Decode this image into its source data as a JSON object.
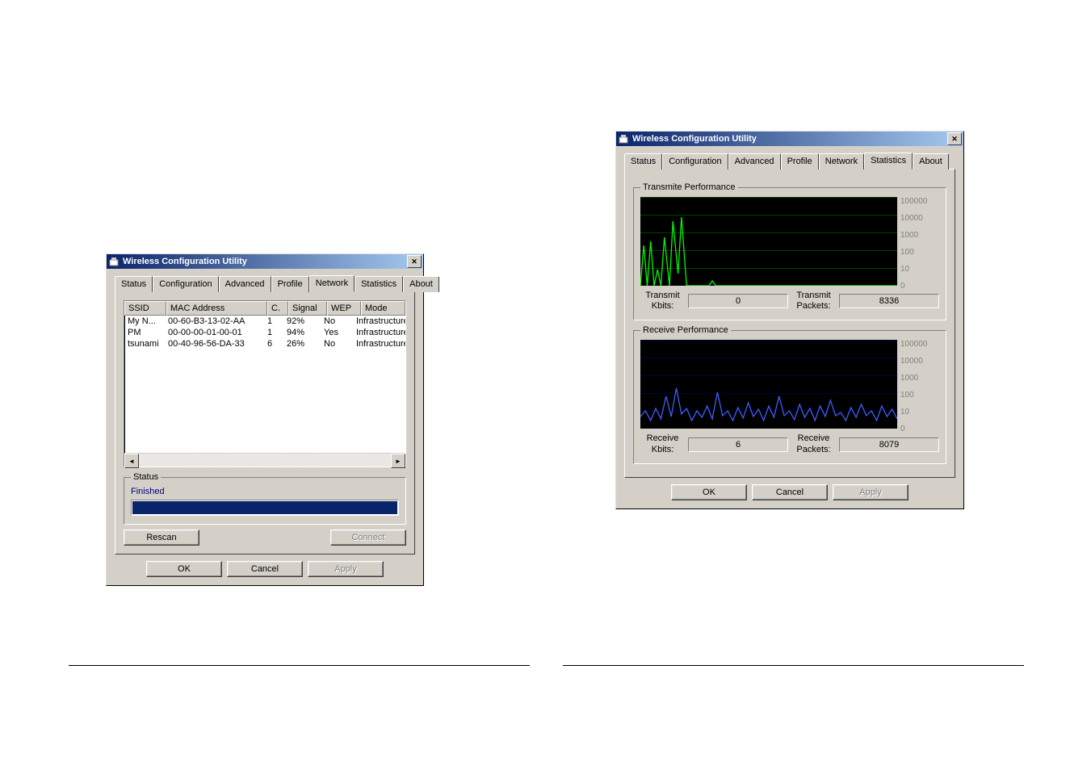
{
  "window1": {
    "title": "Wireless Configuration Utility",
    "tabs": [
      "Status",
      "Configuration",
      "Advanced",
      "Profile",
      "Network",
      "Statistics",
      "About"
    ],
    "active_tab": "Network",
    "columns": {
      "ssid": "SSID",
      "mac": "MAC Address",
      "c": "C.",
      "signal": "Signal",
      "wep": "WEP",
      "mode": "Mode"
    },
    "rows": [
      {
        "ssid": "My N...",
        "mac": "00-60-B3-13-02-AA",
        "c": "1",
        "signal": "92%",
        "wep": "No",
        "mode": "Infrastructure"
      },
      {
        "ssid": "PM",
        "mac": "00-00-00-01-00-01",
        "c": "1",
        "signal": "94%",
        "wep": "Yes",
        "mode": "Infrastructure"
      },
      {
        "ssid": "tsunami",
        "mac": "00-40-96-56-DA-33",
        "c": "6",
        "signal": "26%",
        "wep": "No",
        "mode": "Infrastructure"
      }
    ],
    "status_group": "Status",
    "status_text": "Finished",
    "rescan": "Rescan",
    "connect": "Connect",
    "ok": "OK",
    "cancel": "Cancel",
    "apply": "Apply"
  },
  "window2": {
    "title": "Wireless Configuration Utility",
    "tabs": [
      "Status",
      "Configuration",
      "Advanced",
      "Profile",
      "Network",
      "Statistics",
      "About"
    ],
    "active_tab": "Statistics",
    "transmit_group": "Transmite Performance",
    "receive_group": "Receive Performance",
    "y_labels": [
      "100000",
      "10000",
      "1000",
      "100",
      "10",
      "0"
    ],
    "tx_kbits_label": "Transmit Kbits:",
    "tx_kbits": "0",
    "tx_packets_label": "Transmit Packets:",
    "tx_packets": "8336",
    "rx_kbits_label": "Receive Kbits:",
    "rx_kbits": "6",
    "rx_packets_label": "Receive Packets:",
    "rx_packets": "8079",
    "ok": "OK",
    "cancel": "Cancel",
    "apply": "Apply"
  }
}
